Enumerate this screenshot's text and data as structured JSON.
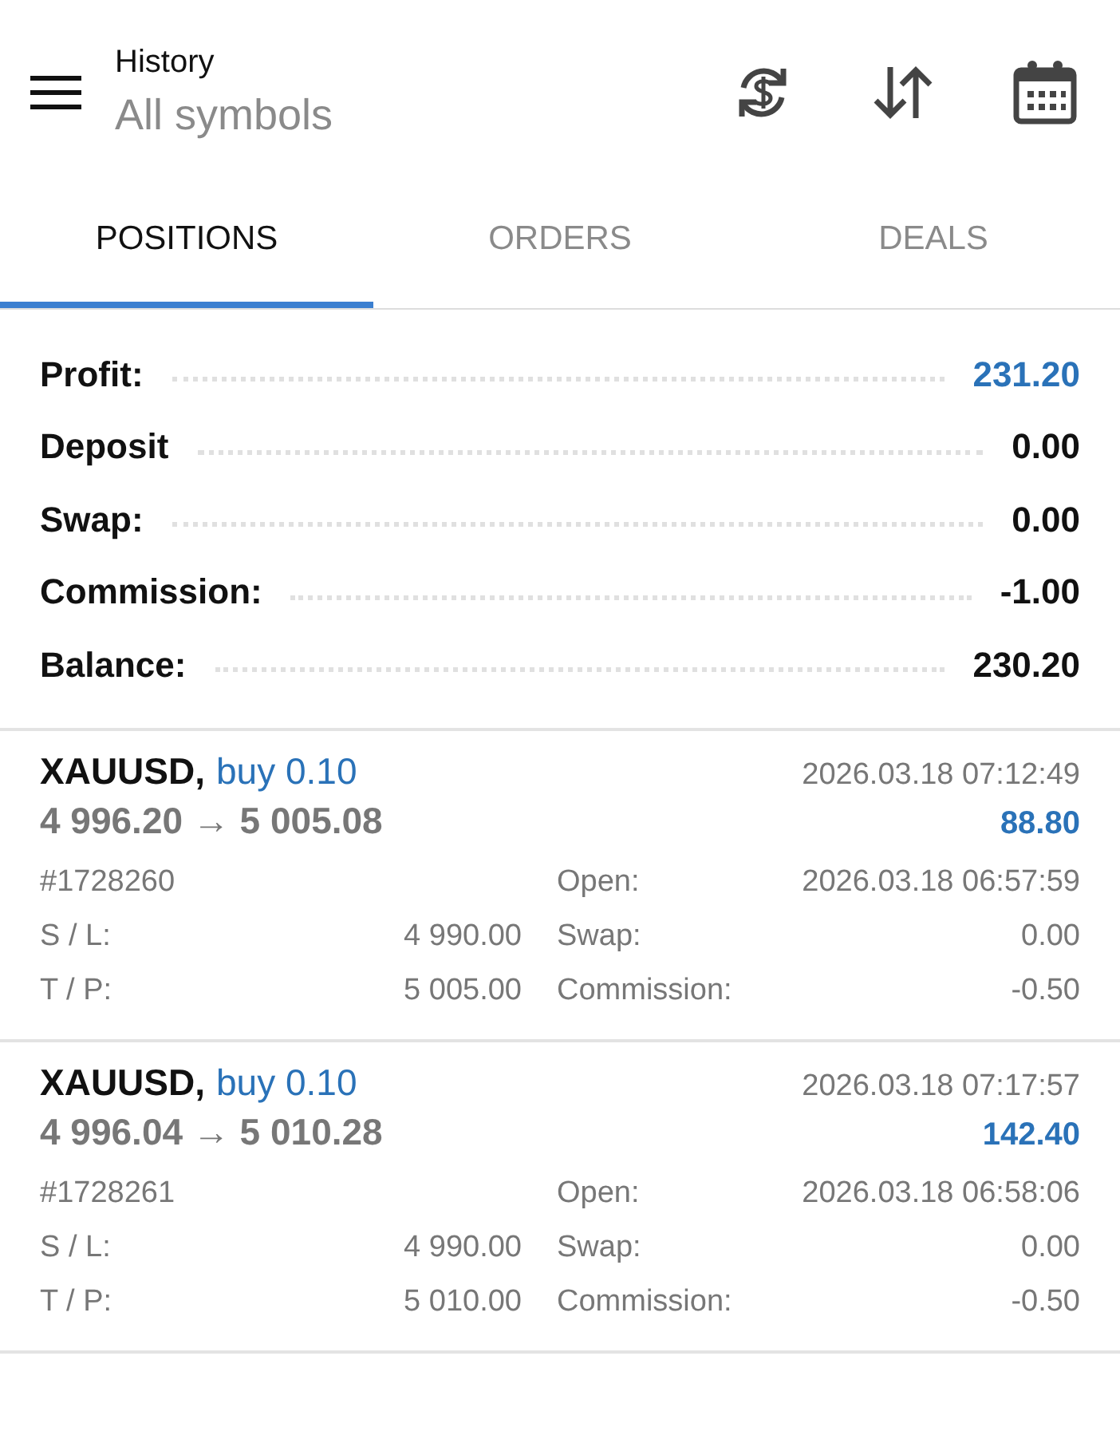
{
  "header": {
    "title": "History",
    "subtitle": "All symbols"
  },
  "tabs": [
    {
      "label": "POSITIONS",
      "selected": true
    },
    {
      "label": "ORDERS",
      "selected": false
    },
    {
      "label": "DEALS",
      "selected": false
    }
  ],
  "summary": [
    {
      "label": "Profit:",
      "value": "231.20",
      "accent": true
    },
    {
      "label": "Deposit",
      "value": "0.00",
      "accent": false
    },
    {
      "label": "Swap:",
      "value": "0.00",
      "accent": false
    },
    {
      "label": "Commission:",
      "value": "-1.00",
      "accent": false
    },
    {
      "label": "Balance:",
      "value": "230.20",
      "accent": false
    }
  ],
  "positions": [
    {
      "symbol": "XAUUSD,",
      "side": "buy 0.10",
      "close_time": "2026.03.18 07:12:49",
      "prices": "4 996.20 → 5 005.08",
      "profit": "88.80",
      "ticket": "#1728260",
      "open_label": "Open:",
      "open_time": "2026.03.18 06:57:59",
      "sl_label": "S / L:",
      "sl": "4 990.00",
      "swap_label": "Swap:",
      "swap": "0.00",
      "tp_label": "T / P:",
      "tp": "5 005.00",
      "commission_label": "Commission:",
      "commission": "-0.50"
    },
    {
      "symbol": "XAUUSD,",
      "side": "buy 0.10",
      "close_time": "2026.03.18 07:17:57",
      "prices": "4 996.04 → 5 010.28",
      "profit": "142.40",
      "ticket": "#1728261",
      "open_label": "Open:",
      "open_time": "2026.03.18 06:58:06",
      "sl_label": "S / L:",
      "sl": "4 990.00",
      "swap_label": "Swap:",
      "swap": "0.00",
      "tp_label": "T / P:",
      "tp": "5 010.00",
      "commission_label": "Commission:",
      "commission": "-0.50"
    }
  ]
}
